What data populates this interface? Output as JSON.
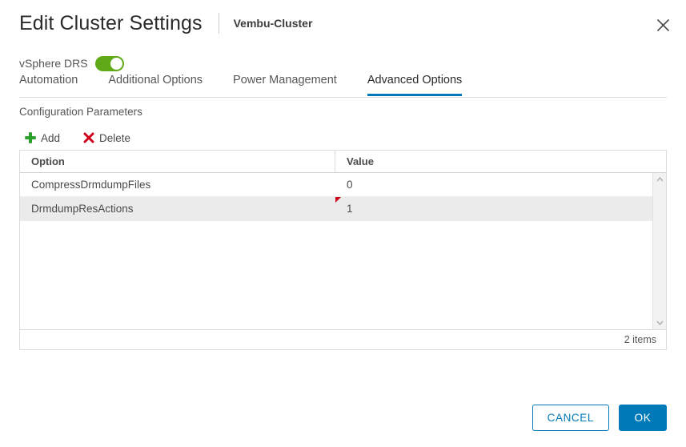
{
  "header": {
    "title": "Edit Cluster Settings",
    "subtitle": "Vembu-Cluster",
    "close_icon": "close-icon"
  },
  "drs": {
    "label": "vSphere DRS",
    "enabled": true,
    "toggle_on_color": "#60a917"
  },
  "tabs": [
    {
      "label": "Automation",
      "active": false
    },
    {
      "label": "Additional Options",
      "active": false
    },
    {
      "label": "Power Management",
      "active": false
    },
    {
      "label": "Advanced Options",
      "active": true
    }
  ],
  "accent_color": "#0079b8",
  "section": {
    "label": "Configuration Parameters"
  },
  "actions": [
    {
      "label": "Add",
      "icon": "plus-icon",
      "color": "#27a527"
    },
    {
      "label": "Delete",
      "icon": "x-mark-icon",
      "color": "#d0021b"
    }
  ],
  "table": {
    "columns": [
      "Option",
      "Value"
    ],
    "rows": [
      {
        "option": "CompressDrmdumpFiles",
        "value": "0",
        "selected": false,
        "marker": false
      },
      {
        "option": "DrmdumpResActions",
        "value": "1",
        "selected": true,
        "marker": true
      }
    ],
    "marker_color": "#d0021b",
    "footer_count": "2 items",
    "scrollbar": {
      "up_icon": "chevron-up-icon",
      "down_icon": "chevron-down-icon"
    }
  },
  "footer": {
    "cancel_label": "CANCEL",
    "ok_label": "OK"
  }
}
